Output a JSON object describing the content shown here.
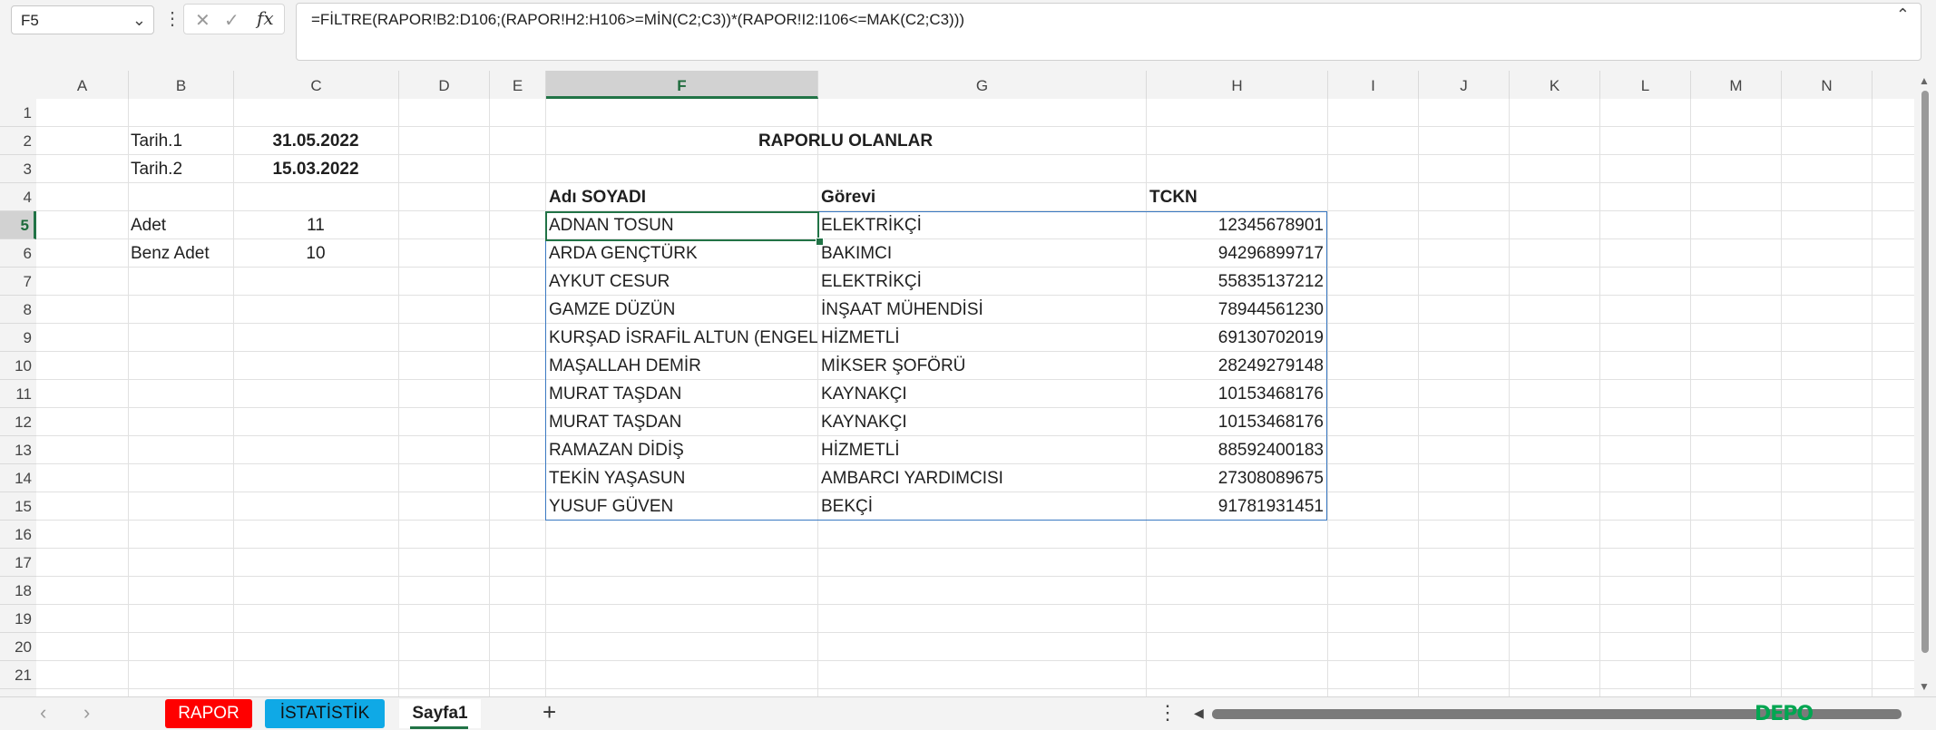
{
  "namebox": {
    "value": "F5",
    "dropdown_icon": "chevron-down-icon"
  },
  "formula_bar": {
    "more_icon": "vertical-dots-icon",
    "cancel_glyph": "✕",
    "enter_glyph": "✓",
    "insert_function": "fx",
    "formula": "=FİLTRE(RAPOR!B2:D106;(RAPOR!H2:H106>=MİN(C2;C3))*(RAPOR!I2:I106<=MAK(C2;C3)))",
    "collapse_icon": "chevron-up-icon"
  },
  "columns": [
    "A",
    "B",
    "C",
    "D",
    "E",
    "F",
    "G",
    "H",
    "I",
    "J",
    "K",
    "L",
    "M",
    "N"
  ],
  "rows": [
    "1",
    "2",
    "3",
    "4",
    "5",
    "6",
    "7",
    "8",
    "9",
    "10",
    "11",
    "12",
    "13",
    "14",
    "15",
    "16",
    "17",
    "18",
    "19",
    "20",
    "21"
  ],
  "sheet": {
    "tarih1_label": "Tarih.1",
    "tarih1_value": "31.05.2022",
    "tarih2_label": "Tarih.2",
    "tarih2_value": "15.03.2022",
    "adet_label": "Adet",
    "adet_value": "11",
    "benz_adet_label": "Benz Adet",
    "benz_adet_value": "10",
    "report_title": "RAPORLU OLANLAR",
    "header_name": "Adı SOYADI",
    "header_job": "Görevi",
    "header_id": "TCKN",
    "records": [
      {
        "name": "ADNAN TOSUN",
        "job": "ELEKTRİKÇİ",
        "id": "12345678901"
      },
      {
        "name": "ARDA GENÇTÜRK",
        "job": "BAKIMCI",
        "id": "94296899717"
      },
      {
        "name": "AYKUT CESUR",
        "job": "ELEKTRİKÇİ",
        "id": "55835137212"
      },
      {
        "name": "GAMZE DÜZÜN",
        "job": "İNŞAAT MÜHENDİSİ",
        "id": "78944561230"
      },
      {
        "name": "KURŞAD İSRAFİL ALTUN (ENGEL",
        "job": "HİZMETLİ",
        "id": "69130702019"
      },
      {
        "name": "MAŞALLAH DEMİR",
        "job": "MİKSER ŞOFÖRÜ",
        "id": "28249279148"
      },
      {
        "name": "MURAT TAŞDAN",
        "job": "KAYNAKÇI",
        "id": "10153468176"
      },
      {
        "name": "MURAT TAŞDAN",
        "job": "KAYNAKÇI",
        "id": "10153468176"
      },
      {
        "name": "RAMAZAN DİDİŞ",
        "job": "HİZMETLİ",
        "id": "88592400183"
      },
      {
        "name": "TEKİN YAŞASUN",
        "job": "AMBARCI YARDIMCISI",
        "id": "27308089675"
      },
      {
        "name": "YUSUF GÜVEN",
        "job": "BEKÇİ",
        "id": "91781931451"
      }
    ]
  },
  "tabs": {
    "prev_icon": "chevron-left-icon",
    "next_icon": "chevron-right-icon",
    "items": [
      {
        "label": "RAPOR",
        "color": "#ff0000"
      },
      {
        "label": "İSTATİSTİK",
        "color": "#0fa9e6"
      },
      {
        "label": "Sayfa1",
        "color": "#ffffff"
      }
    ],
    "add_glyph": "+",
    "options_glyph": "⋮"
  },
  "watermark": "DEPO",
  "colors": {
    "accent": "#217346",
    "spill_border": "#3a79c2"
  }
}
